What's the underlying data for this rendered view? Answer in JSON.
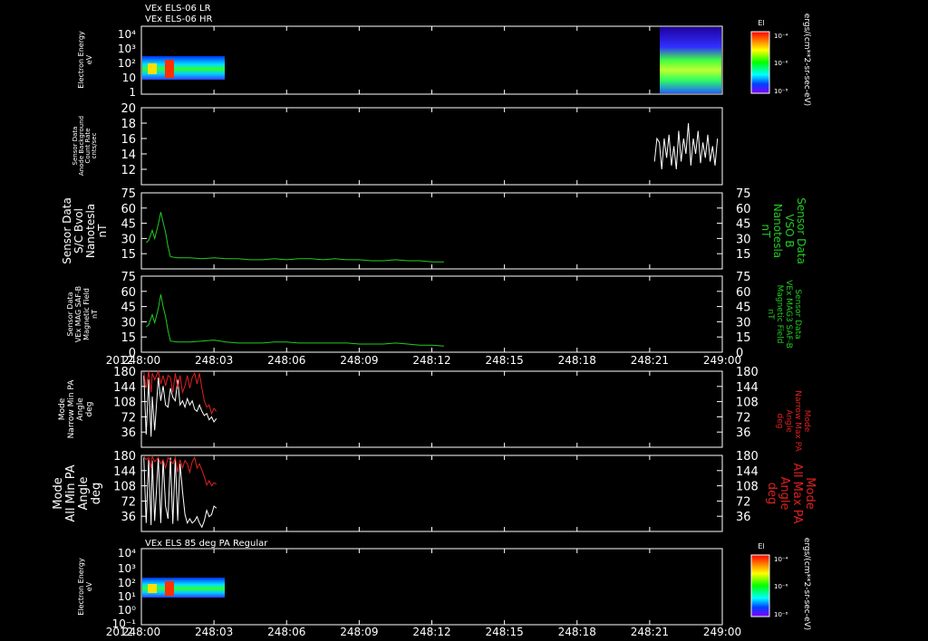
{
  "header": {
    "line1": "VEx ELS-06 LR",
    "line2": "VEx ELS-06 HR"
  },
  "bottom_title": "VEx ELS 85 deg PA Regular",
  "year_label": "2012",
  "x_ticks": [
    "248:00",
    "248:03",
    "248:06",
    "248:09",
    "248:12",
    "248:15",
    "248:18",
    "248:21",
    "249:00"
  ],
  "colors": {
    "background": "#000000",
    "axes": "#ffffff",
    "green": "#22cc22",
    "red": "#e02020",
    "white": "#ffffff"
  },
  "colorbars": [
    {
      "label": "El",
      "ticks": [
        "10⁻⁴",
        "10⁻⁶",
        "10⁻⁸"
      ],
      "unit": "ergs/(cm**2-sr-sec-eV)"
    },
    {
      "label": "El",
      "ticks": [
        "10⁻⁴",
        "10⁻⁶",
        "10⁻⁸"
      ],
      "unit": "ergs/(cm**2-sr-sec-eV)"
    }
  ],
  "chart_data": [
    {
      "type": "heatmap",
      "ylabel": [
        "Electron Energy",
        "eV"
      ],
      "yscale": "log",
      "ytick_labels": [
        "10⁴",
        "10³",
        "10²",
        "10",
        "1"
      ],
      "coverage_minutes": [
        [
          0,
          3.1
        ],
        [
          21.2,
          23.8
        ]
      ]
    },
    {
      "type": "line",
      "ylabel": [
        "Sensor Data",
        "Anode Background",
        "Count Rate",
        "cnts/sec"
      ],
      "ylim": [
        10,
        20
      ],
      "yticks": [
        12,
        14,
        16,
        18,
        20
      ],
      "series": [
        {
          "color": "white",
          "x": [
            21.2,
            21.3,
            21.4,
            21.5,
            21.6,
            21.7,
            21.8,
            21.9,
            22.0,
            22.1,
            22.2,
            22.3,
            22.4,
            22.5,
            22.6,
            22.7,
            22.8,
            22.9,
            23.0,
            23.1,
            23.2,
            23.3,
            23.4,
            23.5,
            23.6,
            23.7,
            23.8
          ],
          "y": [
            13,
            16,
            15.5,
            12,
            16,
            13.5,
            16.5,
            12.5,
            15,
            12,
            17,
            13,
            16,
            14,
            18,
            12.5,
            16,
            14,
            17,
            12.8,
            15.5,
            13.5,
            16.5,
            13,
            15,
            12.5,
            16
          ]
        }
      ]
    },
    {
      "type": "line",
      "ylabel": [
        "Sensor Data",
        "S/C Bvol",
        "Nanotesla",
        "nT"
      ],
      "y2label": [
        "Sensor Data",
        "VSO B",
        "Nanotesla",
        "nT"
      ],
      "ylim": [
        0,
        75
      ],
      "yticks": [
        15,
        30,
        45,
        60,
        75
      ],
      "series": [
        {
          "color": "green",
          "x": [
            0.2,
            0.3,
            0.45,
            0.55,
            0.7,
            0.8,
            0.9,
            1.0,
            1.1,
            1.2,
            1.5,
            2,
            2.5,
            3,
            3.5,
            4,
            4.5,
            5,
            5.5,
            6,
            6.5,
            7,
            7.5,
            8,
            8.5,
            9,
            9.5,
            10,
            10.5,
            11,
            11.5,
            12,
            12.5
          ],
          "y": [
            26,
            28,
            38,
            30,
            44,
            56,
            46,
            36,
            22,
            12,
            11,
            11,
            10,
            11,
            10,
            10,
            9,
            9,
            10,
            9,
            10,
            10,
            9,
            10,
            9,
            9,
            8,
            8,
            9,
            8,
            8,
            7,
            7
          ]
        }
      ]
    },
    {
      "type": "line",
      "ylabel": [
        "Sensor Data",
        "VEx MAG SAF-B",
        "Magnetic Field",
        "nT"
      ],
      "y2label": [
        "Sensor Data",
        "VEx MAG3 SAF-B",
        "Magnetic Field",
        "nT"
      ],
      "ylim": [
        0,
        75
      ],
      "yticks": [
        0,
        15,
        30,
        45,
        60,
        75
      ],
      "series": [
        {
          "color": "green",
          "x": [
            0.2,
            0.3,
            0.45,
            0.55,
            0.7,
            0.8,
            0.9,
            1.0,
            1.1,
            1.2,
            1.5,
            2,
            2.5,
            3,
            3.5,
            4,
            4.5,
            5,
            5.5,
            6,
            6.5,
            7,
            7.5,
            8,
            8.5,
            9,
            9.5,
            10,
            10.5,
            11,
            11.5,
            12,
            12.5
          ],
          "y": [
            25,
            27,
            37,
            29,
            43,
            57,
            45,
            35,
            21,
            11,
            10,
            10,
            11,
            12,
            10,
            9,
            9,
            9,
            10,
            10,
            9,
            9,
            9,
            9,
            9,
            8,
            8,
            8,
            9,
            8,
            7,
            7,
            6
          ]
        }
      ]
    },
    {
      "type": "line",
      "ylabel": [
        "Mode",
        "Narrow Min PA",
        "Angle",
        "deg"
      ],
      "y2label": [
        "Mode",
        "Narrow Max PA",
        "Angle",
        "deg"
      ],
      "ylim": [
        0,
        180
      ],
      "yticks": [
        36,
        72,
        108,
        144,
        180
      ],
      "series": [
        {
          "color": "white",
          "x": [
            0.1,
            0.2,
            0.3,
            0.4,
            0.45,
            0.55,
            0.7,
            0.8,
            0.9,
            1.0,
            1.1,
            1.2,
            1.3,
            1.4,
            1.5,
            1.6,
            1.7,
            1.8,
            1.9,
            2.0,
            2.1,
            2.2,
            2.3,
            2.4,
            2.5,
            2.6,
            2.7,
            2.8,
            2.9,
            3.0,
            3.1
          ],
          "y": [
            170,
            30,
            160,
            25,
            120,
            40,
            165,
            110,
            145,
            100,
            95,
            140,
            118,
            110,
            160,
            100,
            110,
            95,
            115,
            100,
            110,
            90,
            85,
            100,
            85,
            75,
            80,
            65,
            72,
            60,
            68
          ]
        },
        {
          "color": "red",
          "x": [
            0.1,
            0.2,
            0.3,
            0.4,
            0.45,
            0.55,
            0.7,
            0.8,
            0.9,
            1.0,
            1.1,
            1.2,
            1.3,
            1.4,
            1.5,
            1.6,
            1.7,
            1.8,
            1.9,
            2.0,
            2.1,
            2.2,
            2.3,
            2.4,
            2.5,
            2.6,
            2.7,
            2.8,
            2.9,
            3.0,
            3.1
          ],
          "y": [
            178,
            140,
            180,
            130,
            175,
            160,
            180,
            150,
            170,
            145,
            170,
            165,
            130,
            175,
            140,
            170,
            130,
            145,
            170,
            140,
            165,
            175,
            150,
            175,
            140,
            110,
            95,
            100,
            80,
            92,
            85
          ]
        }
      ]
    },
    {
      "type": "line",
      "ylabel": [
        "Mode",
        "All Min PA",
        "Angle",
        "deg"
      ],
      "y2label": [
        "Mode",
        "All Max PA",
        "Angle",
        "deg"
      ],
      "ylim": [
        0,
        180
      ],
      "yticks": [
        36,
        72,
        108,
        144,
        180
      ],
      "series": [
        {
          "color": "white",
          "x": [
            0.1,
            0.2,
            0.3,
            0.4,
            0.45,
            0.55,
            0.7,
            0.8,
            0.9,
            1.0,
            1.1,
            1.2,
            1.3,
            1.4,
            1.5,
            1.6,
            1.7,
            1.8,
            1.9,
            2.0,
            2.1,
            2.2,
            2.3,
            2.4,
            2.5,
            2.6,
            2.7,
            2.8,
            2.9,
            3.0,
            3.1
          ],
          "y": [
            175,
            20,
            170,
            15,
            168,
            25,
            175,
            20,
            170,
            60,
            30,
            175,
            18,
            172,
            25,
            160,
            95,
            40,
            20,
            30,
            20,
            25,
            35,
            20,
            10,
            25,
            50,
            35,
            40,
            60,
            55
          ]
        },
        {
          "color": "red",
          "x": [
            0.1,
            0.2,
            0.3,
            0.4,
            0.45,
            0.55,
            0.7,
            0.8,
            0.9,
            1.0,
            1.1,
            1.2,
            1.3,
            1.4,
            1.5,
            1.6,
            1.7,
            1.8,
            1.9,
            2.0,
            2.1,
            2.2,
            2.3,
            2.4,
            2.5,
            2.6,
            2.7,
            2.8,
            2.9,
            3.0,
            3.1
          ],
          "y": [
            178,
            170,
            175,
            150,
            178,
            165,
            175,
            160,
            170,
            150,
            175,
            168,
            160,
            175,
            140,
            170,
            150,
            168,
            160,
            140,
            165,
            175,
            150,
            160,
            145,
            130,
            110,
            120,
            108,
            115,
            112
          ]
        }
      ]
    },
    {
      "type": "heatmap",
      "ylabel": [
        "Electron Energy",
        "eV"
      ],
      "yscale": "log",
      "ytick_labels": [
        "10⁴",
        "10³",
        "10²",
        "10¹",
        "10⁰",
        "10⁻¹"
      ],
      "coverage_minutes": [
        [
          0,
          3.1
        ]
      ]
    }
  ]
}
